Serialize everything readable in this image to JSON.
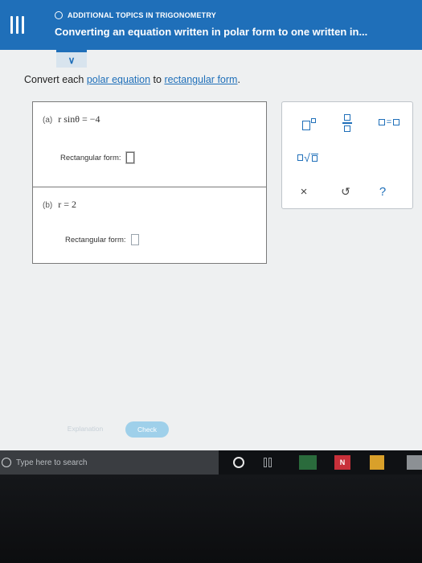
{
  "header": {
    "topic": "ADDITIONAL TOPICS IN TRIGONOMETRY",
    "title": "Converting an equation written in polar form to one written in..."
  },
  "instruction": {
    "prefix": "Convert each ",
    "link1": "polar equation",
    "middle": " to ",
    "link2": "rectangular form",
    "suffix": "."
  },
  "problems": [
    {
      "tag": "(a)",
      "equation": "r sinθ = −4",
      "answer_label": "Rectangular form:",
      "answer_value": ""
    },
    {
      "tag": "(b)",
      "equation": "r = 2",
      "answer_label": "Rectangular form:",
      "answer_value": ""
    }
  ],
  "toolbar": {
    "equals_sign": "=",
    "clear_symbol": "×",
    "undo_symbol": "↺",
    "help_symbol": "?"
  },
  "bottom": {
    "explanation_label": "Explanation",
    "check_label": "Check"
  },
  "taskbar": {
    "search_placeholder": "Type here to search",
    "app2_letter": "N"
  },
  "colors": {
    "header_bg": "#1f6fb9",
    "accent": "#1f6fb9",
    "check_button": "#9fd0ea"
  },
  "icons": [
    "menu-icon",
    "topic-circle-icon",
    "chevron-down-icon",
    "exponent-icon",
    "fraction-icon",
    "equals-template-icon",
    "sqrt-icon",
    "clear-icon",
    "undo-icon",
    "help-icon",
    "search-icon",
    "cortana-icon",
    "task-view-icon"
  ]
}
